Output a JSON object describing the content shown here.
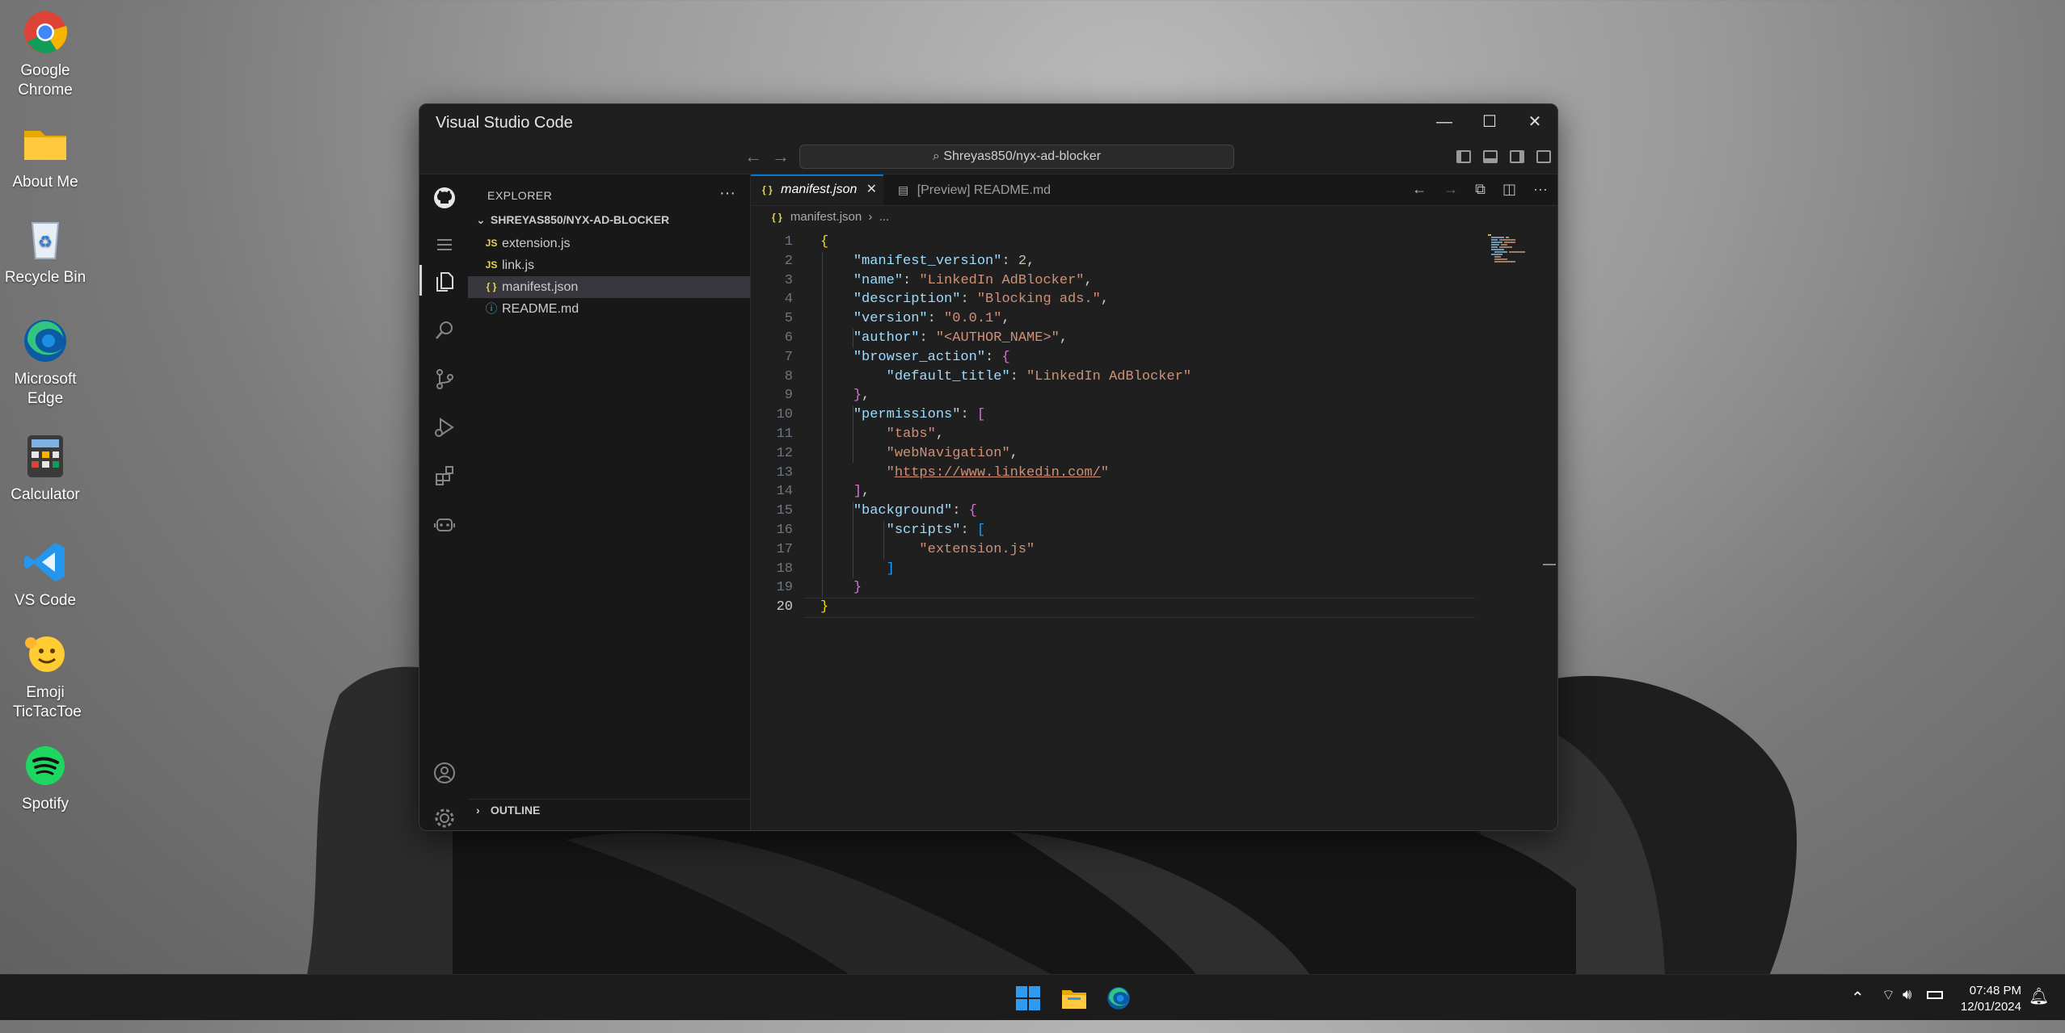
{
  "desktop": {
    "icons": [
      {
        "label": "Google Chrome"
      },
      {
        "label": "About Me"
      },
      {
        "label": "Recycle Bin"
      },
      {
        "label": "Microsoft Edge"
      },
      {
        "label": "Calculator"
      },
      {
        "label": "VS Code"
      },
      {
        "label": "Emoji TicTacToe"
      },
      {
        "label": "Spotify"
      }
    ]
  },
  "window": {
    "title": "Visual Studio Code",
    "command_center": "Shreyas850/nyx-ad-blocker"
  },
  "explorer": {
    "header": "EXPLORER",
    "folder": "SHREYAS850/NYX-AD-BLOCKER",
    "files": [
      {
        "icon": "JS",
        "name": "extension.js"
      },
      {
        "icon": "JS",
        "name": "link.js"
      },
      {
        "icon": "{ }",
        "name": "manifest.json"
      },
      {
        "icon": "ⓘ",
        "name": "README.md"
      }
    ],
    "outline": "OUTLINE"
  },
  "editor": {
    "tabs": [
      {
        "label": "manifest.json",
        "icon": "{ }"
      },
      {
        "label": "[Preview] README.md"
      }
    ],
    "breadcrumb": {
      "file": "manifest.json",
      "rest": "..."
    },
    "lines": [
      {
        "n": "1"
      },
      {
        "n": "2"
      },
      {
        "n": "3"
      },
      {
        "n": "4"
      },
      {
        "n": "5"
      },
      {
        "n": "6"
      },
      {
        "n": "7"
      },
      {
        "n": "8"
      },
      {
        "n": "9"
      },
      {
        "n": "10"
      },
      {
        "n": "11"
      },
      {
        "n": "12"
      },
      {
        "n": "13"
      },
      {
        "n": "14"
      },
      {
        "n": "15"
      },
      {
        "n": "16"
      },
      {
        "n": "17"
      },
      {
        "n": "18"
      },
      {
        "n": "19"
      },
      {
        "n": "20"
      }
    ],
    "code": {
      "manifest_version_key": "\"manifest_version\"",
      "manifest_version_val": "2",
      "name_key": "\"name\"",
      "name_val": "\"LinkedIn AdBlocker\"",
      "description_key": "\"description\"",
      "description_val": "\"Blocking ads.\"",
      "version_key": "\"version\"",
      "version_val": "\"0.0.1\"",
      "author_key": "\"author\"",
      "author_val": "\"<AUTHOR_NAME>\"",
      "browser_action_key": "\"browser_action\"",
      "default_title_key": "\"default_title\"",
      "default_title_val": "\"LinkedIn AdBlocker\"",
      "permissions_key": "\"permissions\"",
      "perm_tabs": "\"tabs\"",
      "perm_webnav": "\"webNavigation\"",
      "perm_url": "https://www.linkedin.com/",
      "background_key": "\"background\"",
      "scripts_key": "\"scripts\"",
      "script_ext": "\"extension.js\""
    }
  },
  "taskbar": {
    "time": "07:48 PM",
    "date": "12/01/2024"
  },
  "colors": {
    "accent": "#0078d4",
    "editor_bg": "#1f1f1f",
    "sidebar_bg": "#181818"
  }
}
